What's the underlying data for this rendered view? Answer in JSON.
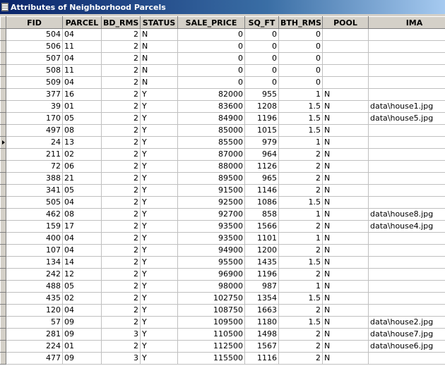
{
  "window": {
    "title": "Attributes of Neighborhood Parcels"
  },
  "table": {
    "columns": [
      "FID",
      "PARCEL",
      "BD_RMS",
      "STATUS",
      "SALE_PRICE",
      "SQ_FT",
      "BTH_RMS",
      "POOL",
      "IMA"
    ],
    "rows": [
      [
        "504",
        "04",
        "2",
        "N",
        "0",
        "0",
        "0",
        "",
        ""
      ],
      [
        "506",
        "11",
        "2",
        "N",
        "0",
        "0",
        "0",
        "",
        ""
      ],
      [
        "507",
        "04",
        "2",
        "N",
        "0",
        "0",
        "0",
        "",
        ""
      ],
      [
        "508",
        "11",
        "2",
        "N",
        "0",
        "0",
        "0",
        "",
        ""
      ],
      [
        "509",
        "04",
        "2",
        "N",
        "0",
        "0",
        "0",
        "",
        ""
      ],
      [
        "377",
        "16",
        "2",
        "Y",
        "82000",
        "955",
        "1",
        "N",
        ""
      ],
      [
        "39",
        "01",
        "2",
        "Y",
        "83600",
        "1208",
        "1.5",
        "N",
        "data\\house1.jpg"
      ],
      [
        "170",
        "05",
        "2",
        "Y",
        "84900",
        "1196",
        "1.5",
        "N",
        "data\\house5.jpg"
      ],
      [
        "497",
        "08",
        "2",
        "Y",
        "85000",
        "1015",
        "1.5",
        "N",
        ""
      ],
      [
        "24",
        "13",
        "2",
        "Y",
        "85500",
        "979",
        "1",
        "N",
        ""
      ],
      [
        "211",
        "02",
        "2",
        "Y",
        "87000",
        "964",
        "2",
        "N",
        ""
      ],
      [
        "72",
        "06",
        "2",
        "Y",
        "88000",
        "1126",
        "2",
        "N",
        ""
      ],
      [
        "388",
        "21",
        "2",
        "Y",
        "89500",
        "965",
        "2",
        "N",
        ""
      ],
      [
        "341",
        "05",
        "2",
        "Y",
        "91500",
        "1146",
        "2",
        "N",
        ""
      ],
      [
        "505",
        "04",
        "2",
        "Y",
        "92500",
        "1086",
        "1.5",
        "N",
        ""
      ],
      [
        "462",
        "08",
        "2",
        "Y",
        "92700",
        "858",
        "1",
        "N",
        "data\\house8.jpg"
      ],
      [
        "159",
        "17",
        "2",
        "Y",
        "93500",
        "1566",
        "2",
        "N",
        "data\\house4.jpg"
      ],
      [
        "400",
        "04",
        "2",
        "Y",
        "93500",
        "1101",
        "1",
        "N",
        ""
      ],
      [
        "107",
        "04",
        "2",
        "Y",
        "94900",
        "1200",
        "2",
        "N",
        ""
      ],
      [
        "134",
        "14",
        "2",
        "Y",
        "95500",
        "1435",
        "1.5",
        "N",
        ""
      ],
      [
        "242",
        "12",
        "2",
        "Y",
        "96900",
        "1196",
        "2",
        "N",
        ""
      ],
      [
        "488",
        "05",
        "2",
        "Y",
        "98000",
        "987",
        "1",
        "N",
        ""
      ],
      [
        "435",
        "02",
        "2",
        "Y",
        "102750",
        "1354",
        "1.5",
        "N",
        ""
      ],
      [
        "120",
        "04",
        "2",
        "Y",
        "108750",
        "1663",
        "2",
        "N",
        ""
      ],
      [
        "57",
        "09",
        "2",
        "Y",
        "109500",
        "1180",
        "1.5",
        "N",
        "data\\house2.jpg"
      ],
      [
        "281",
        "09",
        "3",
        "Y",
        "110500",
        "1498",
        "2",
        "N",
        "data\\house7.jpg"
      ],
      [
        "224",
        "01",
        "2",
        "Y",
        "112500",
        "1567",
        "2",
        "N",
        "data\\house6.jpg"
      ],
      [
        "477",
        "09",
        "3",
        "Y",
        "115500",
        "1116",
        "2",
        "N",
        ""
      ]
    ],
    "current_row_index": 9
  }
}
